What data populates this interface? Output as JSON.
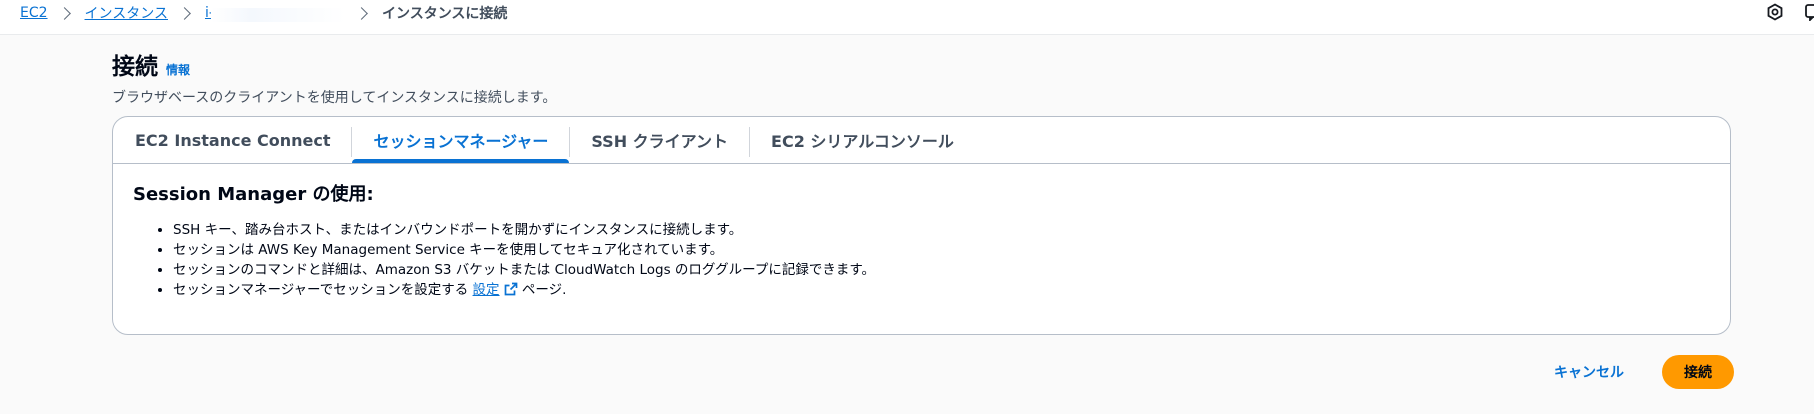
{
  "breadcrumb": {
    "ec2": "EC2",
    "instances": "インスタンス",
    "instance_id": "i-",
    "current": "インスタンスに接続"
  },
  "header": {
    "title": "接続",
    "info_link": "情報",
    "description": "ブラウザベースのクライアントを使用してインスタンスに接続します。"
  },
  "tabs": [
    {
      "label": "EC2 Instance Connect",
      "active": false
    },
    {
      "label": "セッションマネージャー",
      "active": true
    },
    {
      "label": "SSH クライアント",
      "active": false
    },
    {
      "label": "EC2 シリアルコンソール",
      "active": false
    }
  ],
  "panel": {
    "heading": "Session Manager の使用:",
    "bullets": [
      "SSH キー、踏み台ホスト、またはインバウンドポートを開かずにインスタンスに接続します。",
      "セッションは AWS Key Management Service キーを使用してセキュア化されています。",
      "セッションのコマンドと詳細は、Amazon S3 バケットまたは CloudWatch Logs のロググループに記録できます。"
    ],
    "last_bullet": {
      "prefix": "セッションマネージャーでセッションを設定する ",
      "link": "設定",
      "suffix": " ページ."
    }
  },
  "actions": {
    "cancel": "キャンセル",
    "connect": "接続"
  },
  "colors": {
    "link": "#0972d3",
    "primary_button": "#ff9900",
    "border": "#b6bec9"
  },
  "icons": [
    "chevron-right-icon",
    "external-link-icon",
    "settings-icon",
    "notifications-icon"
  ]
}
